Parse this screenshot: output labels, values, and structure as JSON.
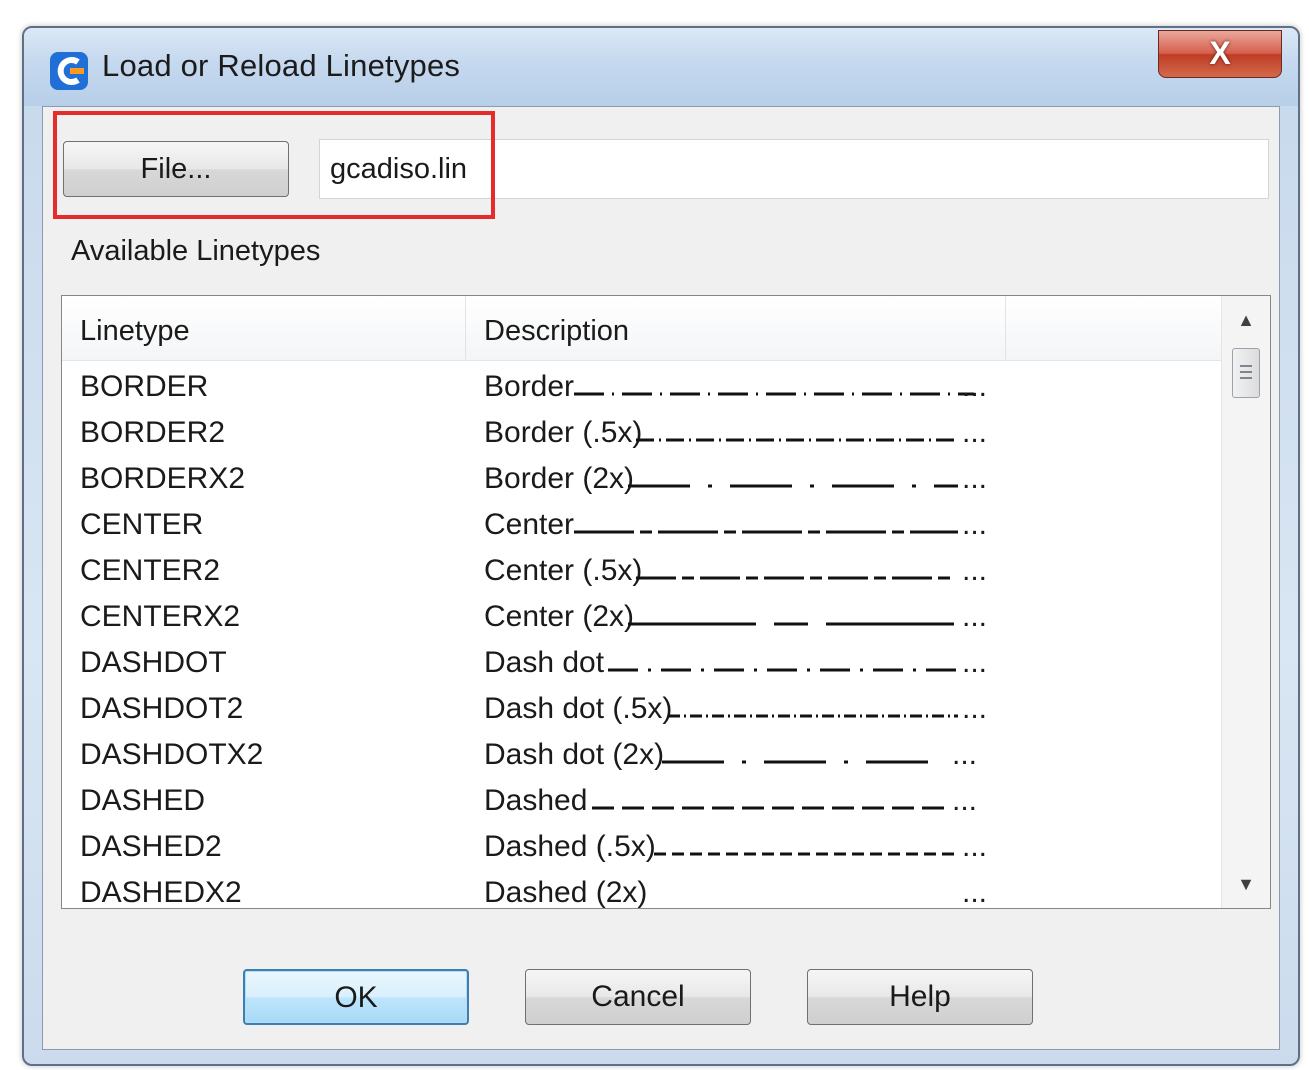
{
  "window": {
    "title": "Load or Reload Linetypes",
    "close_glyph": "X",
    "icon": "app-logo-icon",
    "accent": "#e62b2b"
  },
  "file": {
    "button_label": "File...",
    "value": "gcadiso.lin"
  },
  "available_label": "Available Linetypes",
  "table": {
    "columns": [
      "Linetype",
      "Description"
    ],
    "rows": [
      {
        "linetype": "BORDER",
        "description": "Border"
      },
      {
        "linetype": "BORDER2",
        "description": "Border (.5x)"
      },
      {
        "linetype": "BORDERX2",
        "description": "Border (2x)"
      },
      {
        "linetype": "CENTER",
        "description": "Center"
      },
      {
        "linetype": "CENTER2",
        "description": "Center (.5x)"
      },
      {
        "linetype": "CENTERX2",
        "description": "Center (2x)"
      },
      {
        "linetype": "DASHDOT",
        "description": "Dash dot"
      },
      {
        "linetype": "DASHDOT2",
        "description": "Dash dot (.5x)"
      },
      {
        "linetype": "DASHDOTX2",
        "description": "Dash dot (2x)"
      },
      {
        "linetype": "DASHED",
        "description": "Dashed"
      },
      {
        "linetype": "DASHED2",
        "description": "Dashed (.5x)"
      },
      {
        "linetype": "DASHEDX2",
        "description": "Dashed (2x)"
      }
    ],
    "ellipsis": "..."
  },
  "buttons": {
    "ok": "OK",
    "cancel": "Cancel",
    "help": "Help"
  }
}
